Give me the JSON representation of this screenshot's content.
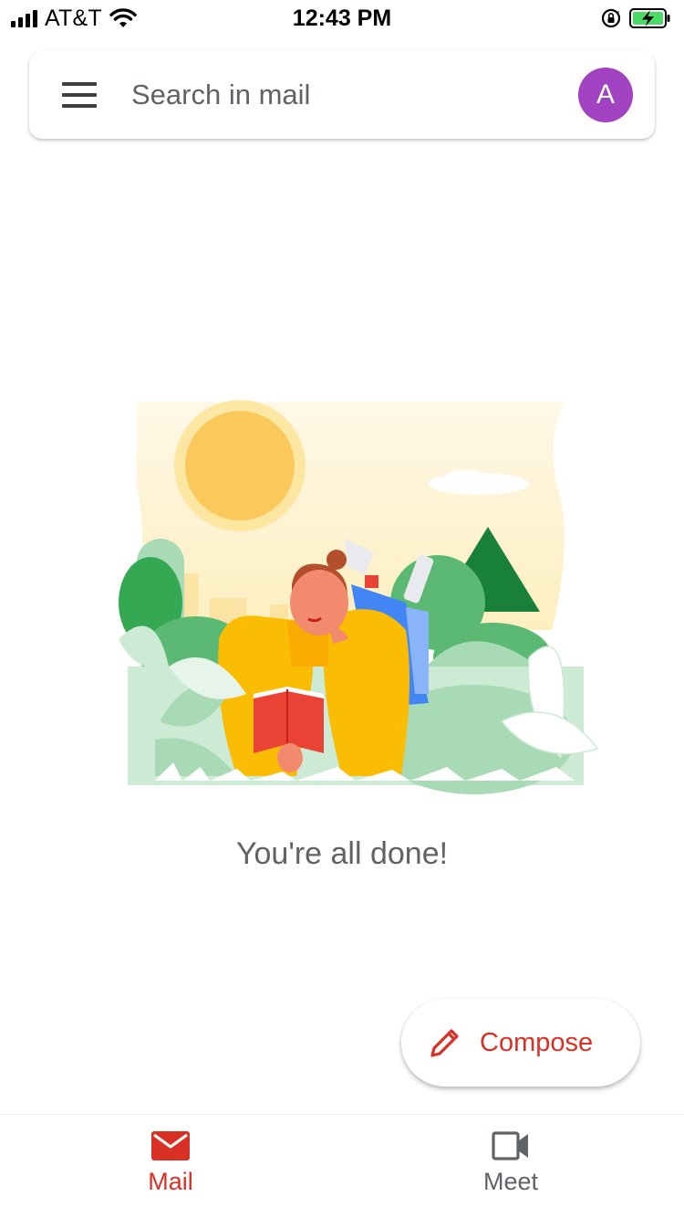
{
  "status_bar": {
    "carrier": "AT&T",
    "time": "12:43 PM",
    "icons": [
      "signal-bars-icon",
      "wifi-icon",
      "orientation-lock-icon",
      "battery-charging-icon"
    ]
  },
  "search": {
    "placeholder": "Search in mail",
    "menu_icon": "hamburger-menu-icon",
    "avatar_letter": "A",
    "avatar_color": "#a142c3"
  },
  "empty_state": {
    "message": "You're all done!",
    "illustration": "person-reading-in-park"
  },
  "compose": {
    "label": "Compose",
    "icon": "pencil-icon",
    "color": "#d93025"
  },
  "bottom_nav": {
    "items": [
      {
        "label": "Mail",
        "icon": "mail-icon",
        "active": true,
        "color": "#d93025"
      },
      {
        "label": "Meet",
        "icon": "video-camera-icon",
        "active": false,
        "color": "#5f6368"
      }
    ]
  }
}
